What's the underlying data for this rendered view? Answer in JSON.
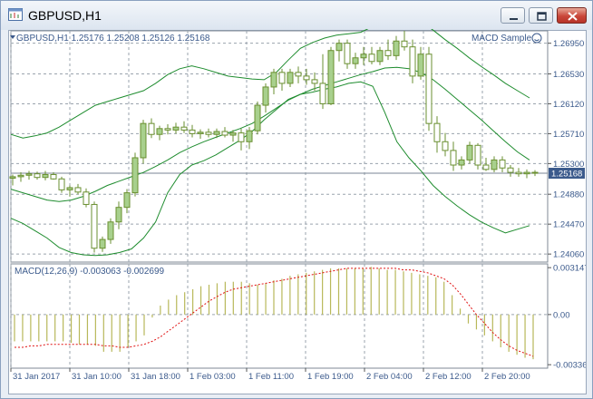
{
  "window": {
    "title": "GBPUSD,H1"
  },
  "main_chart": {
    "header": "GBPUSD,H1  1.25176 1.25208 1.25126 1.25168",
    "ea_label": "MACD Sample",
    "current_price": "1.25168",
    "price_levels": [
      "1.26950",
      "1.26530",
      "1.26120",
      "1.25710",
      "1.25300",
      "1.24880",
      "1.24470",
      "1.24060"
    ]
  },
  "macd_panel": {
    "header": "MACD(12,26,9) -0.003063 -0.002699",
    "levels": [
      "0.003147",
      "0.00",
      "-0.003367"
    ]
  },
  "time_axis": [
    "31 Jan 2017",
    "31 Jan 10:00",
    "31 Jan 18:00",
    "1 Feb 03:00",
    "1 Feb 11:00",
    "1 Feb 19:00",
    "2 Feb 04:00",
    "2 Feb 12:00",
    "2 Feb 20:00"
  ],
  "colors": {
    "bull": "#a8d08d",
    "bear": "#ffffff",
    "outline": "#6a8f30",
    "band": "#1e8c2e",
    "macd_hist": "#b8b85a",
    "signal": "#e01010",
    "grid": "#9aa3ad",
    "axis_text": "#3b5a8c"
  },
  "chart_data": {
    "type": "candlestick",
    "symbol": "GBPUSD",
    "timeframe": "H1",
    "ylim": [
      1.2395,
      1.2712
    ],
    "candles": [
      [
        1.251,
        1.2515,
        1.25,
        1.2512
      ],
      [
        1.2512,
        1.2518,
        1.2505,
        1.2514
      ],
      [
        1.2514,
        1.252,
        1.2508,
        1.2516
      ],
      [
        1.2516,
        1.2519,
        1.2508,
        1.2511
      ],
      [
        1.2511,
        1.252,
        1.2507,
        1.2515
      ],
      [
        1.2515,
        1.2518,
        1.2508,
        1.2509
      ],
      [
        1.2509,
        1.2512,
        1.249,
        1.2494
      ],
      [
        1.2494,
        1.25,
        1.2485,
        1.2497
      ],
      [
        1.2497,
        1.2502,
        1.2488,
        1.2491
      ],
      [
        1.2491,
        1.2496,
        1.247,
        1.2474
      ],
      [
        1.2474,
        1.2478,
        1.2408,
        1.2414
      ],
      [
        1.2414,
        1.243,
        1.2409,
        1.2426
      ],
      [
        1.2426,
        1.2455,
        1.242,
        1.245
      ],
      [
        1.245,
        1.2478,
        1.244,
        1.247
      ],
      [
        1.247,
        1.2495,
        1.2462,
        1.249
      ],
      [
        1.249,
        1.2545,
        1.2485,
        1.2538
      ],
      [
        1.2538,
        1.259,
        1.253,
        1.2585
      ],
      [
        1.2585,
        1.2592,
        1.2565,
        1.257
      ],
      [
        1.257,
        1.2582,
        1.2562,
        1.2578
      ],
      [
        1.2578,
        1.2584,
        1.257,
        1.2576
      ],
      [
        1.2576,
        1.2586,
        1.2571,
        1.258
      ],
      [
        1.258,
        1.2588,
        1.2572,
        1.2576
      ],
      [
        1.2576,
        1.2583,
        1.2566,
        1.2571
      ],
      [
        1.2571,
        1.2577,
        1.2564,
        1.2573
      ],
      [
        1.2573,
        1.2578,
        1.2566,
        1.257
      ],
      [
        1.257,
        1.2578,
        1.2565,
        1.2574
      ],
      [
        1.2574,
        1.258,
        1.2566,
        1.2569
      ],
      [
        1.2569,
        1.2576,
        1.256,
        1.2572
      ],
      [
        1.2572,
        1.2578,
        1.2548,
        1.256
      ],
      [
        1.256,
        1.258,
        1.255,
        1.2575
      ],
      [
        1.2575,
        1.2615,
        1.257,
        1.261
      ],
      [
        1.261,
        1.264,
        1.26,
        1.2635
      ],
      [
        1.2635,
        1.266,
        1.2625,
        1.2655
      ],
      [
        1.2655,
        1.266,
        1.263,
        1.264
      ],
      [
        1.264,
        1.266,
        1.2635,
        1.2655
      ],
      [
        1.2655,
        1.2663,
        1.264,
        1.265
      ],
      [
        1.265,
        1.266,
        1.2638,
        1.2645
      ],
      [
        1.2645,
        1.2655,
        1.263,
        1.264
      ],
      [
        1.264,
        1.268,
        1.2605,
        1.2612
      ],
      [
        1.2612,
        1.269,
        1.261,
        1.2685
      ],
      [
        1.2685,
        1.27,
        1.267,
        1.2695
      ],
      [
        1.2695,
        1.27,
        1.266,
        1.2667
      ],
      [
        1.2667,
        1.2682,
        1.266,
        1.2675
      ],
      [
        1.2675,
        1.269,
        1.2665,
        1.268
      ],
      [
        1.268,
        1.269,
        1.2666,
        1.267
      ],
      [
        1.267,
        1.269,
        1.2665,
        1.2685
      ],
      [
        1.2685,
        1.27,
        1.2672,
        1.2678
      ],
      [
        1.2678,
        1.2705,
        1.2672,
        1.2698
      ],
      [
        1.2698,
        1.2712,
        1.2685,
        1.269
      ],
      [
        1.269,
        1.27,
        1.264,
        1.265
      ],
      [
        1.265,
        1.269,
        1.2645,
        1.268
      ],
      [
        1.268,
        1.269,
        1.2575,
        1.2585
      ],
      [
        1.2585,
        1.2595,
        1.2545,
        1.256
      ],
      [
        1.256,
        1.2572,
        1.254,
        1.2548
      ],
      [
        1.2548,
        1.256,
        1.252,
        1.2528
      ],
      [
        1.2528,
        1.254,
        1.2522,
        1.2535
      ],
      [
        1.2535,
        1.256,
        1.253,
        1.2555
      ],
      [
        1.2555,
        1.2558,
        1.2522,
        1.2528
      ],
      [
        1.2528,
        1.2538,
        1.252,
        1.2522
      ],
      [
        1.2522,
        1.254,
        1.2518,
        1.2535
      ],
      [
        1.2535,
        1.254,
        1.2518,
        1.2524
      ],
      [
        1.2524,
        1.2528,
        1.2512,
        1.2518
      ],
      [
        1.2518,
        1.2524,
        1.2512,
        1.2516
      ],
      [
        1.2516,
        1.2522,
        1.251,
        1.2518
      ],
      [
        1.2518,
        1.2521,
        1.2513,
        1.2517
      ]
    ],
    "bollinger": {
      "upper": [
        1.257,
        1.2565,
        1.2568,
        1.2572,
        1.258,
        1.259,
        1.26,
        1.261,
        1.2615,
        1.262,
        1.2625,
        1.263,
        1.264,
        1.2652,
        1.266,
        1.2664,
        1.266,
        1.2655,
        1.265,
        1.2648,
        1.2646,
        1.2645,
        1.2655,
        1.2672,
        1.2688,
        1.2696,
        1.2702,
        1.2706,
        1.2708,
        1.271,
        1.2718,
        1.273,
        1.2735,
        1.2733,
        1.2725,
        1.2713,
        1.27,
        1.2688,
        1.2675,
        1.2663,
        1.2652,
        1.264,
        1.263,
        1.262
      ],
      "middle": [
        1.2495,
        1.249,
        1.2485,
        1.248,
        1.2478,
        1.248,
        1.2485,
        1.2492,
        1.25,
        1.2506,
        1.2512,
        1.2518,
        1.2526,
        1.2535,
        1.2545,
        1.2553,
        1.256,
        1.2566,
        1.2572,
        1.2578,
        1.2585,
        1.2595,
        1.2606,
        1.2617,
        1.2625,
        1.2632,
        1.2637,
        1.2642,
        1.2647,
        1.2652,
        1.2656,
        1.2661,
        1.2662,
        1.266,
        1.2655,
        1.2645,
        1.2632,
        1.2618,
        1.2604,
        1.259,
        1.2575,
        1.256,
        1.2546,
        1.2535
      ],
      "lower": [
        1.2455,
        1.2448,
        1.2438,
        1.2428,
        1.2415,
        1.2408,
        1.2405,
        1.2404,
        1.2405,
        1.2408,
        1.2413,
        1.2428,
        1.245,
        1.249,
        1.2515,
        1.2528,
        1.2534,
        1.2542,
        1.2552,
        1.2562,
        1.2574,
        1.259,
        1.2604,
        1.2618,
        1.2625,
        1.2628,
        1.2632,
        1.2635,
        1.264,
        1.2642,
        1.2636,
        1.26,
        1.256,
        1.2538,
        1.252,
        1.25,
        1.2485,
        1.2472,
        1.246,
        1.245,
        1.2442,
        1.2435,
        1.244,
        1.2445
      ]
    },
    "macd": {
      "ylim": [
        -0.0036,
        0.0034
      ],
      "histogram": [
        -0.0018,
        -0.0018,
        -0.0018,
        -0.0018,
        -0.0018,
        -0.0018,
        -0.0018,
        -0.0019,
        -0.002,
        -0.002,
        -0.0021,
        -0.0025,
        -0.0025,
        -0.0025,
        -0.0022,
        -0.0018,
        -0.0014,
        -0.0002,
        0.0006,
        0.001,
        0.0013,
        0.0015,
        0.0017,
        0.0019,
        0.002,
        0.0021,
        0.0022,
        0.0022,
        0.0022,
        0.0021,
        0.002,
        0.0021,
        0.0023,
        0.0024,
        0.0026,
        0.0027,
        0.0028,
        0.0029,
        0.003,
        0.0031,
        0.0031,
        0.0031,
        0.0031,
        0.0031,
        0.0032,
        0.0031,
        0.003,
        0.003,
        0.0029,
        0.0028,
        0.0027,
        0.0026,
        0.0025,
        0.0022,
        0.0013,
        0.0004,
        -0.0006,
        -0.001,
        -0.0014,
        -0.0018,
        -0.0022,
        -0.0025,
        -0.0027,
        -0.0029,
        -0.003
      ],
      "signal": [
        -0.0022,
        -0.0022,
        -0.0021,
        -0.0021,
        -0.002,
        -0.002,
        -0.002,
        -0.002,
        -0.002,
        -0.002,
        -0.002,
        -0.0021,
        -0.0021,
        -0.0022,
        -0.0022,
        -0.0021,
        -0.002,
        -0.0018,
        -0.0015,
        -0.0011,
        -0.0007,
        -0.0003,
        0.0001,
        0.0005,
        0.0009,
        0.0012,
        0.0015,
        0.0017,
        0.0018,
        0.0019,
        0.002,
        0.0021,
        0.0022,
        0.0023,
        0.0024,
        0.0025,
        0.0026,
        0.0027,
        0.0028,
        0.0029,
        0.003,
        0.0031,
        0.0031,
        0.0031,
        0.0031,
        0.0031,
        0.0031,
        0.0031,
        0.003,
        0.003,
        0.0029,
        0.0028,
        0.0026,
        0.0024,
        0.002,
        0.0014,
        0.0007,
        0.0,
        -0.0006,
        -0.0012,
        -0.0017,
        -0.0021,
        -0.0024,
        -0.0026,
        -0.0028
      ]
    }
  }
}
